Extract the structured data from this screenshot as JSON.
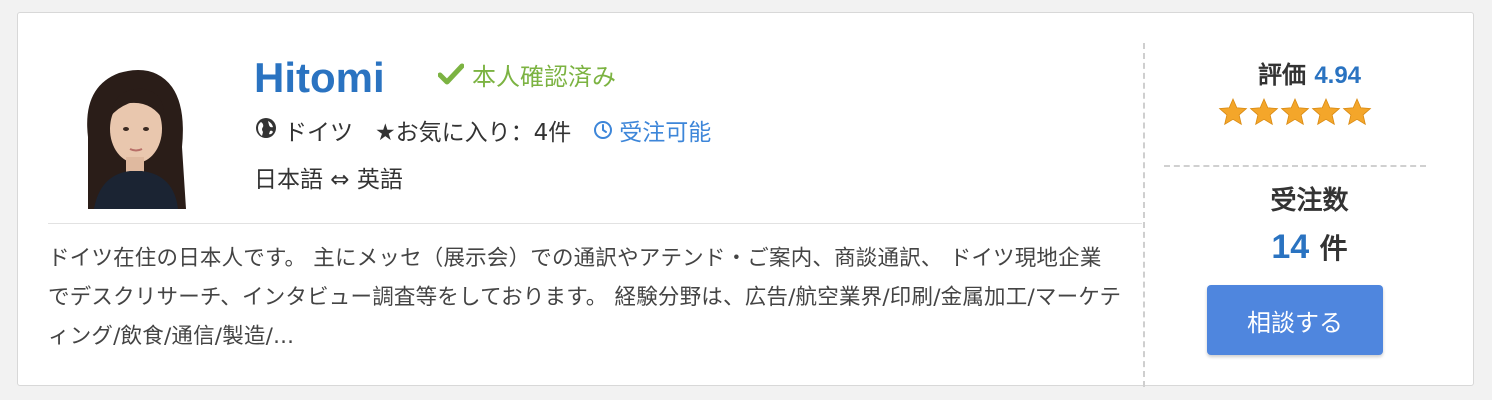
{
  "profile": {
    "name": "Hitomi",
    "verified_label": "本人確認済み",
    "country": "ドイツ",
    "favorites": "★お気に入り：4件",
    "availability": "受注可能",
    "languages": "日本語 ⇔ 英語",
    "description": "ドイツ在住の日本人です。 主にメッセ（展示会）での通訳やアテンド・ご案内、商談通訳、 ドイツ現地企業でデスクリサーチ、インタビュー調査等をしております。 経験分野は、広告/航空業界/印刷/金属加工/マーケティング/飲食/通信/製造/..."
  },
  "stats": {
    "rating_label": "評価",
    "rating_value": "4.94",
    "stars": 5,
    "orders_label": "受注数",
    "orders_value": "14",
    "orders_unit": "件",
    "consult_button": "相談する"
  },
  "colors": {
    "accent": "#2a73c1",
    "verified": "#7cb342",
    "button": "#4f86de",
    "star": "#f4a62a"
  },
  "icons": {
    "verified": "check-icon",
    "country": "globe-icon",
    "availability": "clock-icon"
  }
}
